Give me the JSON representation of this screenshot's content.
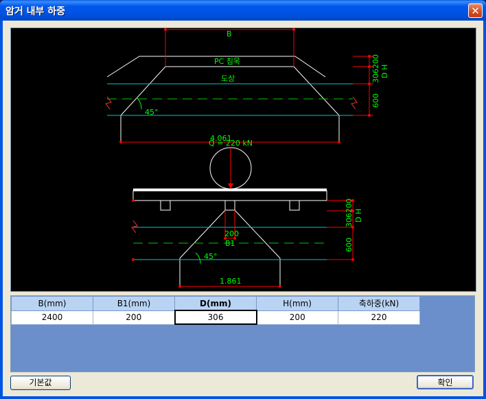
{
  "window": {
    "title": "암거 내부 하중"
  },
  "drawing": {
    "top": {
      "b_label": "B",
      "pc_label": "PC 침목",
      "ballast_label": "도상",
      "angle_label": "45°",
      "dim_right_label": "306200",
      "dh_label": "D  H",
      "depth_label": "600",
      "width_value": "4.061",
      "load_label": "Q = 220 kN"
    },
    "bottom": {
      "dim_right_label": "306200",
      "dh_label": "D  H",
      "depth_label": "600",
      "b1_value": "200",
      "b1_label": "B1",
      "angle_label": "45°",
      "width_value": "1.861"
    }
  },
  "grid": {
    "headers": [
      "B(mm)",
      "B1(mm)",
      "D(mm)",
      "H(mm)",
      "축하중(kN)"
    ],
    "active_column": 2,
    "values": [
      "2400",
      "200",
      "306",
      "200",
      "220"
    ]
  },
  "buttons": {
    "default_label": "기본값",
    "ok_label": "확인"
  },
  "colors": {
    "line": "#ffffff",
    "dim": "#ff0000",
    "text": "#00ff00",
    "cyan": "#00c8c8"
  }
}
